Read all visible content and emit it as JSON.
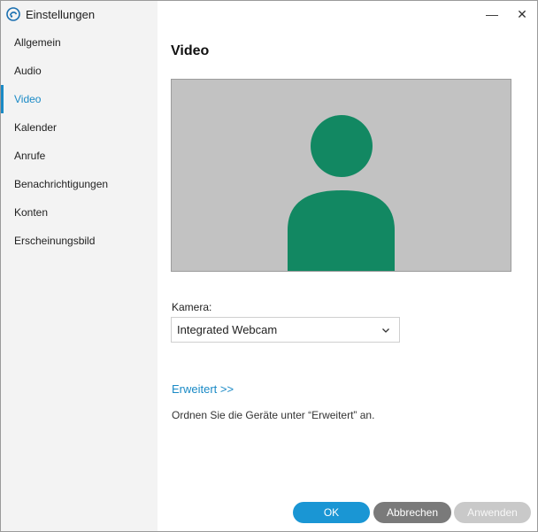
{
  "window": {
    "title": "Einstellungen",
    "icon": "skype-logo-icon",
    "controls": {
      "minimize": "—",
      "close": "✕"
    }
  },
  "sidebar": {
    "items": [
      {
        "label": "Allgemein",
        "active": false
      },
      {
        "label": "Audio",
        "active": false
      },
      {
        "label": "Video",
        "active": true
      },
      {
        "label": "Kalender",
        "active": false
      },
      {
        "label": "Anrufe",
        "active": false
      },
      {
        "label": "Benachrichtigungen",
        "active": false
      },
      {
        "label": "Konten",
        "active": false
      },
      {
        "label": "Erscheinungsbild",
        "active": false
      }
    ]
  },
  "main": {
    "title": "Video",
    "preview": {
      "placeholder_icon": "person-avatar-icon",
      "avatar_color": "#128862"
    },
    "camera": {
      "label": "Kamera:",
      "selected": "Integrated Webcam"
    },
    "advanced_link": "Erweitert >>",
    "hint": "Ordnen Sie die Geräte unter “Erweitert” an."
  },
  "buttons": {
    "ok": "OK",
    "cancel": "Abbrechen",
    "apply": "Anwenden"
  },
  "colors": {
    "accent": "#1a8ac6",
    "sidebar_bg": "#f3f3f3",
    "preview_bg": "#c2c2c2"
  }
}
